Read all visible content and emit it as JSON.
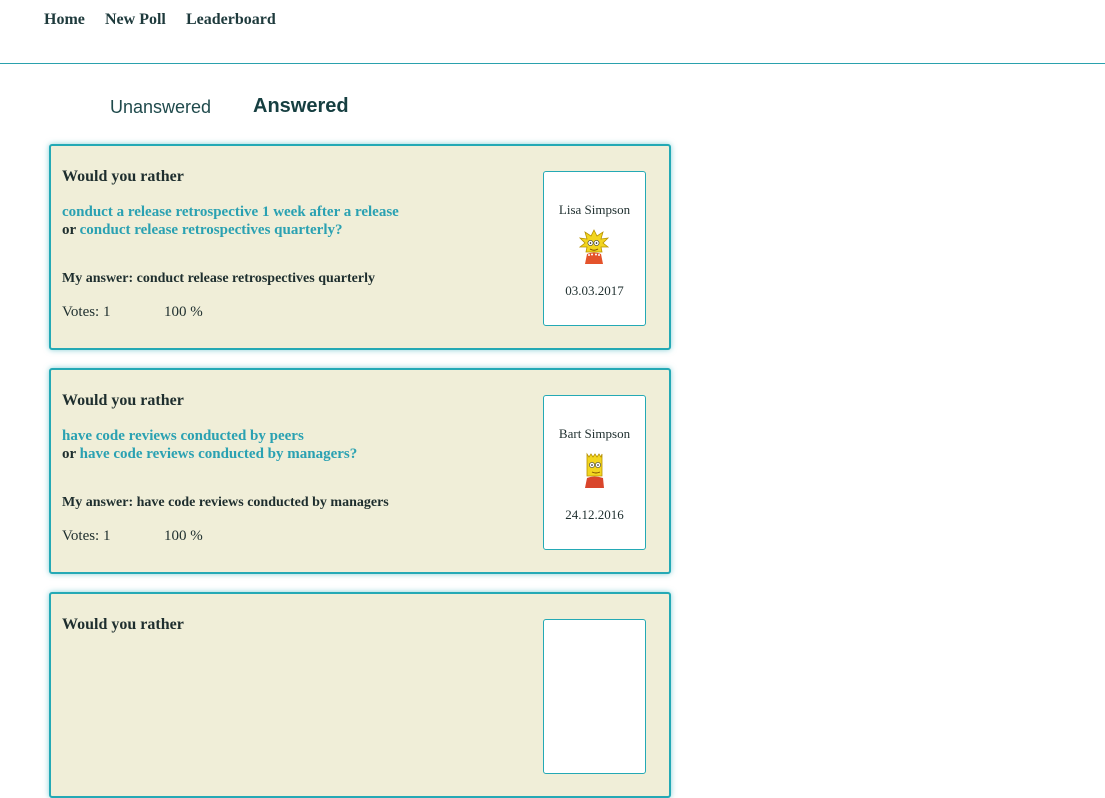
{
  "nav": {
    "home": "Home",
    "new_poll": "New Poll",
    "leaderboard": "Leaderboard"
  },
  "tabs": {
    "unanswered": "Unanswered",
    "answered": "Answered",
    "active": "answered"
  },
  "polls": [
    {
      "heading": "Would you rather",
      "option_one": "conduct a release retrospective 1 week after a release",
      "or_word": "or",
      "option_two": "conduct release retrospectives quarterly?",
      "my_answer": "My answer: conduct release retrospectives quarterly",
      "votes": "Votes: 1",
      "percent": "100 %",
      "author": "Lisa Simpson",
      "avatar_icon": "lisa-simpson-avatar-icon",
      "date": "03.03.2017"
    },
    {
      "heading": "Would you rather",
      "option_one": "have code reviews conducted by peers",
      "or_word": "or",
      "option_two": "have code reviews conducted by managers?",
      "my_answer": "My answer: have code reviews conducted by managers",
      "votes": "Votes: 1",
      "percent": "100 %",
      "author": "Bart Simpson",
      "avatar_icon": "bart-simpson-avatar-icon",
      "date": "24.12.2016"
    },
    {
      "heading": "Would you rather"
    }
  ],
  "colors": {
    "accent": "#24a9b5",
    "card_bg": "#f0eed8",
    "text": "#1e2e2e",
    "link": "#2aa1b2"
  }
}
